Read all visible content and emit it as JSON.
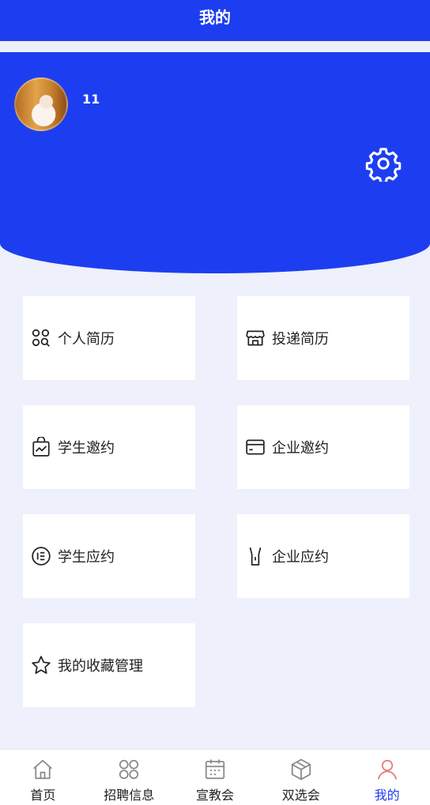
{
  "header": {
    "title": "我的"
  },
  "profile": {
    "username": "11"
  },
  "menu": [
    {
      "label": "个人简历",
      "icon": "user-search-icon"
    },
    {
      "label": "投递简历",
      "icon": "store-icon"
    },
    {
      "label": "学生邀约",
      "icon": "shopping-bag-chart-icon"
    },
    {
      "label": "企业邀约",
      "icon": "card-icon"
    },
    {
      "label": "学生应约",
      "icon": "list-circle-icon"
    },
    {
      "label": "企业应约",
      "icon": "flashlight-icon"
    },
    {
      "label": "我的收藏管理",
      "icon": "star-icon"
    }
  ],
  "tabs": [
    {
      "label": "首页",
      "icon": "home-icon"
    },
    {
      "label": "招聘信息",
      "icon": "grid-icon"
    },
    {
      "label": "宣教会",
      "icon": "calendar-icon"
    },
    {
      "label": "双选会",
      "icon": "box-icon"
    },
    {
      "label": "我的",
      "icon": "user-icon",
      "active": true
    }
  ],
  "colors": {
    "primary": "#1d3ef0",
    "background": "#eef0fc"
  }
}
